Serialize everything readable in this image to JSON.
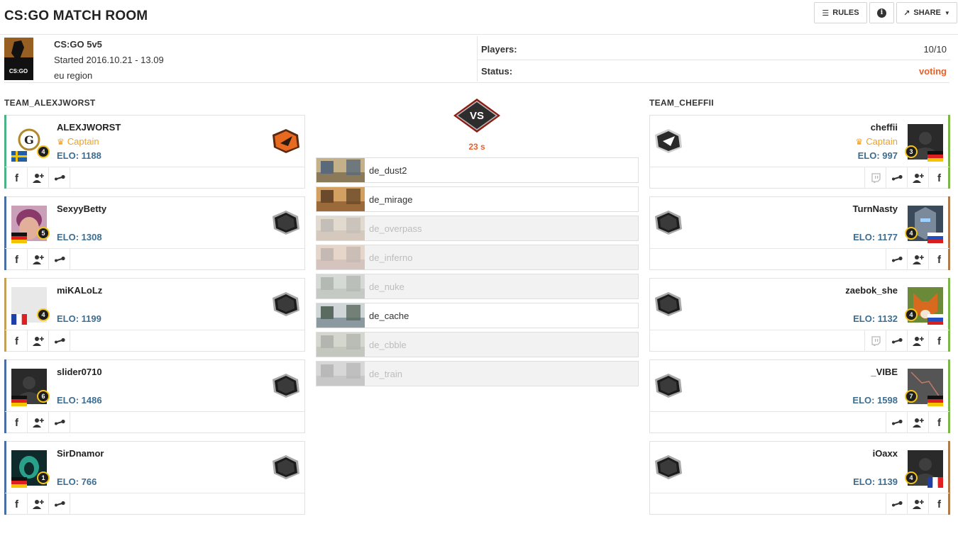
{
  "header": {
    "title": "CS:GO MATCH ROOM",
    "rules_label": "RULES",
    "info_label": "i",
    "share_label": "SHARE"
  },
  "match": {
    "game_logo_text": "CS:GO",
    "mode": "CS:GO 5v5",
    "started": "Started 2016.10.21 - 13.09",
    "region": "eu region",
    "players_label": "Players:",
    "players_value": "10/10",
    "status_label": "Status:",
    "status_value": "voting",
    "status_color": "#e8612c"
  },
  "center": {
    "vs_label": "VS",
    "timer": "23 s",
    "maps": [
      {
        "name": "de_dust2",
        "state": "available",
        "palette": [
          "#8a7a5a",
          "#c4b089",
          "#5a6a7a"
        ]
      },
      {
        "name": "de_mirage",
        "state": "available",
        "palette": [
          "#9a6a3a",
          "#d2a060",
          "#6a4a2a"
        ]
      },
      {
        "name": "de_overpass",
        "state": "dropped",
        "palette": [
          "#a08060",
          "#c8b090",
          "#706050"
        ]
      },
      {
        "name": "de_inferno",
        "state": "dropped",
        "palette": [
          "#a07060",
          "#d0a080",
          "#705040"
        ]
      },
      {
        "name": "de_nuke",
        "state": "dropped",
        "palette": [
          "#708070",
          "#a0b0a0",
          "#405040"
        ]
      },
      {
        "name": "de_cache",
        "state": "available",
        "palette": [
          "#8a9aa0",
          "#d0d6d8",
          "#5a6a60"
        ]
      },
      {
        "name": "de_cbble",
        "state": "dropped",
        "palette": [
          "#707a60",
          "#a0a890",
          "#404a38"
        ]
      },
      {
        "name": "de_train",
        "state": "dropped",
        "palette": [
          "#7a7a7a",
          "#a8a8a8",
          "#505050"
        ]
      }
    ]
  },
  "team_left": {
    "name": "TEAM_ALEXJWORST",
    "players": [
      {
        "name": "ALEXJWORST",
        "captain": "Captain",
        "elo": "ELO: 1188",
        "level": "4",
        "flag": "sweden",
        "stripe": "#4db383",
        "avatar": "logo",
        "rank": "orange",
        "actions": [
          "facebook-icon",
          "add-friend-icon",
          "steam-icon"
        ]
      },
      {
        "name": "SexyyBetty",
        "captain": "",
        "elo": "ELO: 1308",
        "level": "5",
        "flag": "germany",
        "stripe": "#4a6fa5",
        "avatar": "photo-pink",
        "rank": "dark",
        "actions": [
          "facebook-icon",
          "add-friend-icon",
          "steam-icon"
        ]
      },
      {
        "name": "miKALoLz",
        "captain": "",
        "elo": "ELO: 1199",
        "level": "4",
        "flag": "france",
        "stripe": "#c2a05a",
        "avatar": "blank",
        "rank": "dark",
        "actions": [
          "facebook-icon",
          "add-friend-icon",
          "steam-icon"
        ]
      },
      {
        "name": "slider0710",
        "captain": "",
        "elo": "ELO: 1486",
        "level": "6",
        "flag": "germany",
        "stripe": "#4a6fa5",
        "avatar": "default",
        "rank": "dark",
        "actions": [
          "facebook-icon",
          "add-friend-icon",
          "steam-icon"
        ]
      },
      {
        "name": "SirDnamor",
        "captain": "",
        "elo": "ELO: 766",
        "level": "1",
        "flag": "germany",
        "stripe": "#4a6fa5",
        "avatar": "photo-green",
        "rank": "dark",
        "actions": [
          "facebook-icon",
          "add-friend-icon",
          "steam-icon"
        ]
      }
    ]
  },
  "team_right": {
    "name": "TEAM_CHEFFII",
    "players": [
      {
        "name": "cheffii",
        "captain": "Captain",
        "elo": "ELO: 997",
        "level": "3",
        "flag": "germany",
        "stripe": "#7ab648",
        "avatar": "default",
        "rank": "white",
        "actions": [
          "twitch-icon",
          "steam-icon",
          "add-friend-icon",
          "facebook-icon"
        ]
      },
      {
        "name": "TurnNasty",
        "captain": "",
        "elo": "ELO: 1177",
        "level": "4",
        "flag": "russia",
        "stripe": "#b07a4a",
        "avatar": "photo-armor",
        "rank": "dark",
        "actions": [
          "steam-icon",
          "add-friend-icon",
          "facebook-icon"
        ]
      },
      {
        "name": "zaebok_she",
        "captain": "",
        "elo": "ELO: 1132",
        "level": "4",
        "flag": "russia",
        "stripe": "#7ab648",
        "avatar": "photo-fox",
        "rank": "dark",
        "actions": [
          "twitch-icon",
          "steam-icon",
          "add-friend-icon",
          "facebook-icon"
        ]
      },
      {
        "name": "_VIBE",
        "captain": "",
        "elo": "ELO: 1598",
        "level": "7",
        "flag": "germany",
        "stripe": "#7ab648",
        "avatar": "photo-dark",
        "rank": "dark",
        "actions": [
          "steam-icon",
          "add-friend-icon",
          "facebook-icon"
        ]
      },
      {
        "name": "iOaxx",
        "captain": "",
        "elo": "ELO: 1139",
        "level": "4",
        "flag": "france",
        "stripe": "#b07a4a",
        "avatar": "default",
        "rank": "dark",
        "actions": [
          "steam-icon",
          "add-friend-icon",
          "facebook-icon"
        ]
      }
    ]
  }
}
